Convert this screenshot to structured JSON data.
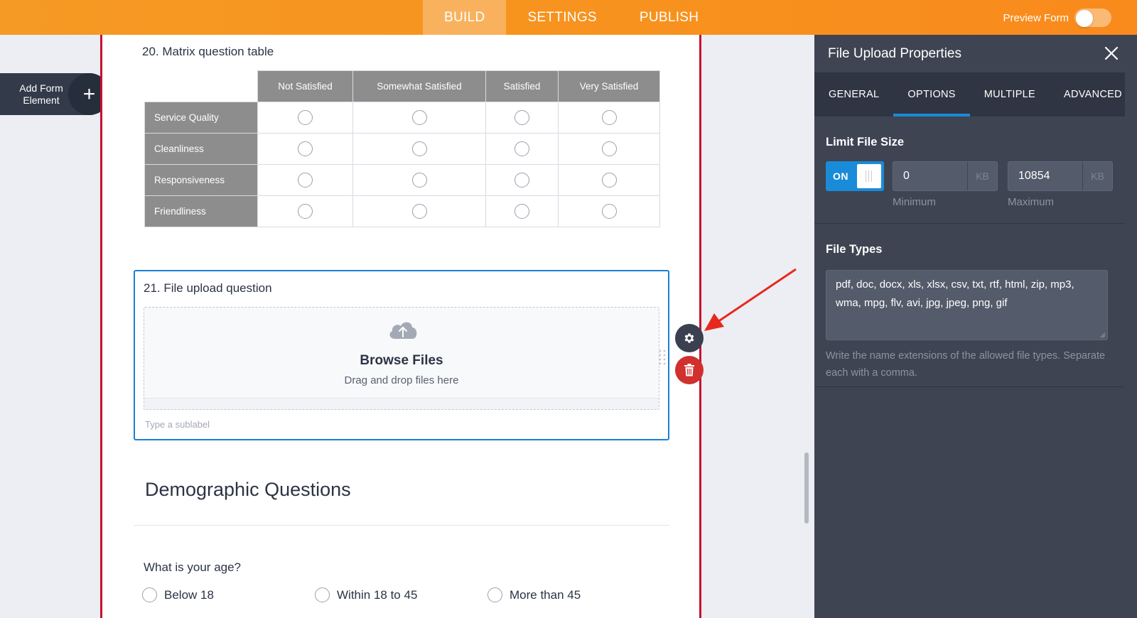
{
  "topbar": {
    "tabs": [
      "BUILD",
      "SETTINGS",
      "PUBLISH"
    ],
    "preview_label": "Preview Form"
  },
  "add_element": {
    "label": "Add Form Element",
    "plus": "+"
  },
  "matrix": {
    "title": "20. Matrix question table",
    "columns": [
      "Not Satisfied",
      "Somewhat Satisfied",
      "Satisfied",
      "Very Satisfied"
    ],
    "rows": [
      "Service Quality",
      "Cleanliness",
      "Responsiveness",
      "Friendliness"
    ]
  },
  "upload": {
    "title": "21. File upload question",
    "browse": "Browse Files",
    "drag": "Drag and drop files here",
    "sublabel_placeholder": "Type a sublabel"
  },
  "demographic": {
    "section_title": "Demographic Questions",
    "age_question": "What is your age?",
    "age_options": [
      "Below 18",
      "Within 18 to 45",
      "More than 45"
    ]
  },
  "panel": {
    "title": "File Upload Properties",
    "tabs": [
      "GENERAL",
      "OPTIONS",
      "MULTIPLE",
      "ADVANCED"
    ],
    "active_tab": "OPTIONS",
    "limit_label": "Limit File Size",
    "toggle_text": "ON",
    "minimum": {
      "value": "0",
      "unit": "KB",
      "label": "Minimum"
    },
    "maximum": {
      "value": "10854",
      "unit": "KB",
      "label": "Maximum"
    },
    "types_label": "File Types",
    "types_value": "pdf, doc, docx, xls, xlsx, csv, txt, rtf, html, zip, mp3, wma, mpg, flv, avi, jpg, jpeg, png, gif",
    "help_text": "Write the name extensions of the allowed file types. Separate each with a comma."
  },
  "colors": {
    "accent_orange": "#f7931e",
    "selection_blue": "#1a7fd4",
    "canvas_border": "#c8102e",
    "delete_red": "#d0302e",
    "arrow_red": "#e8281e"
  },
  "icons": [
    "cloud-upload-icon",
    "gear-icon",
    "trash-icon",
    "close-icon",
    "drag-handle-icon",
    "plus-icon"
  ]
}
